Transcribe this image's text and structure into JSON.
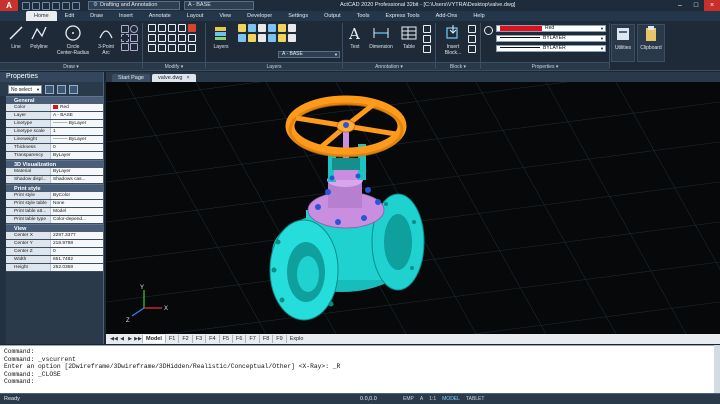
{
  "titlebar": {
    "logo": "A",
    "workspace": "Drafting and Annotation",
    "layer_quick": "A - BASE",
    "title": "ActCAD 2020 Professional 32bit - [C:\\Users\\VYTRA\\Desktop\\valve.dwg]",
    "minimize": "–",
    "maximize": "□",
    "close": "×"
  },
  "menu_tabs": [
    "Home",
    "Edit",
    "Draw",
    "Insert",
    "Annotate",
    "Layout",
    "View",
    "Developer",
    "Settings",
    "Output",
    "Tools",
    "Express Tools",
    "Add-Ons",
    "Help"
  ],
  "ribbon": {
    "draw": {
      "line": "Line",
      "polyline": "Polyline",
      "circle": "Circle",
      "circle_sub": "Center-Radius",
      "arc": "3-Point",
      "arc_sub": "Arc",
      "label": "Draw ▾"
    },
    "modify": {
      "label": "Modify ▾"
    },
    "layers": {
      "button": "Layers",
      "current": "A - BASE",
      "label": "Layers"
    },
    "annotation": {
      "text": "Text",
      "dimension": "Dimension",
      "table": "Table",
      "label": "Annotation ▾"
    },
    "block": {
      "insert": "Insert",
      "insert_sub": "Block...",
      "label": "Block ▾"
    },
    "properties": {
      "color": "Red",
      "linetype": "BYLAYER",
      "lineweight": "BYLAYER",
      "label": "Properties ▾"
    },
    "utilities": "Utilities",
    "clipboard": "Clipboard"
  },
  "palette": {
    "title": "Properties",
    "selection": "No select",
    "sections": [
      {
        "name": "General",
        "rows": [
          {
            "k": "Color",
            "v": "Red",
            "swatch": true
          },
          {
            "k": "Layer",
            "v": "A - BASE"
          },
          {
            "k": "Linetype",
            "v": "——— ByLayer"
          },
          {
            "k": "Linetype scale",
            "v": "1"
          },
          {
            "k": "Lineweight",
            "v": "——— ByLayer"
          },
          {
            "k": "Thickness",
            "v": "0"
          },
          {
            "k": "Transparency",
            "v": "ByLayer"
          }
        ]
      },
      {
        "name": "3D Visualization",
        "rows": [
          {
            "k": "Material",
            "v": "ByLayer"
          },
          {
            "k": "Shadow displ...",
            "v": "Shadows cas..."
          }
        ]
      },
      {
        "name": "Print style",
        "rows": [
          {
            "k": "Print style",
            "v": "ByColor"
          },
          {
            "k": "Print style table",
            "v": "None"
          },
          {
            "k": "Print table att...",
            "v": "Model"
          },
          {
            "k": "Print table type",
            "v": "Color-depend..."
          }
        ]
      },
      {
        "name": "View",
        "rows": [
          {
            "k": "Center X",
            "v": "2297.3377"
          },
          {
            "k": "Center Y",
            "v": "218.9798"
          },
          {
            "k": "Center Z",
            "v": "0"
          },
          {
            "k": "Width",
            "v": "651.7482"
          },
          {
            "k": "Height",
            "v": "252.0368"
          }
        ]
      }
    ]
  },
  "doc_tabs": [
    {
      "label": "Start Page",
      "active": false
    },
    {
      "label": "valve.dwg",
      "active": true,
      "close": "×"
    }
  ],
  "layout_tabs": [
    "Model",
    "F1",
    "F2",
    "F3",
    "F4",
    "F5",
    "F6",
    "F7",
    "F8",
    "F9",
    "Explo"
  ],
  "axes": {
    "x": "X",
    "y": "Y",
    "z": "Z"
  },
  "command_lines": [
    "Command:",
    "Command: _vscurrent",
    "Enter an option [2Dwireframe/3Dwireframe/3DHidden/Realistic/Conceptual/Other] <X-Ray>: _R",
    "Command: _CLOSE",
    "Command:"
  ],
  "status": {
    "ready": "Ready",
    "coords": "0.0,0.0",
    "buttons": [
      "EMP",
      "A",
      "1:1",
      "MODEL",
      "TABLET"
    ]
  },
  "colors": {
    "accent": "#1f2a38",
    "valve_body": "#1fd1cf",
    "handwheel": "#ff9a1a",
    "bonnet": "#c98ee0",
    "bolts": "#2a56d6"
  }
}
